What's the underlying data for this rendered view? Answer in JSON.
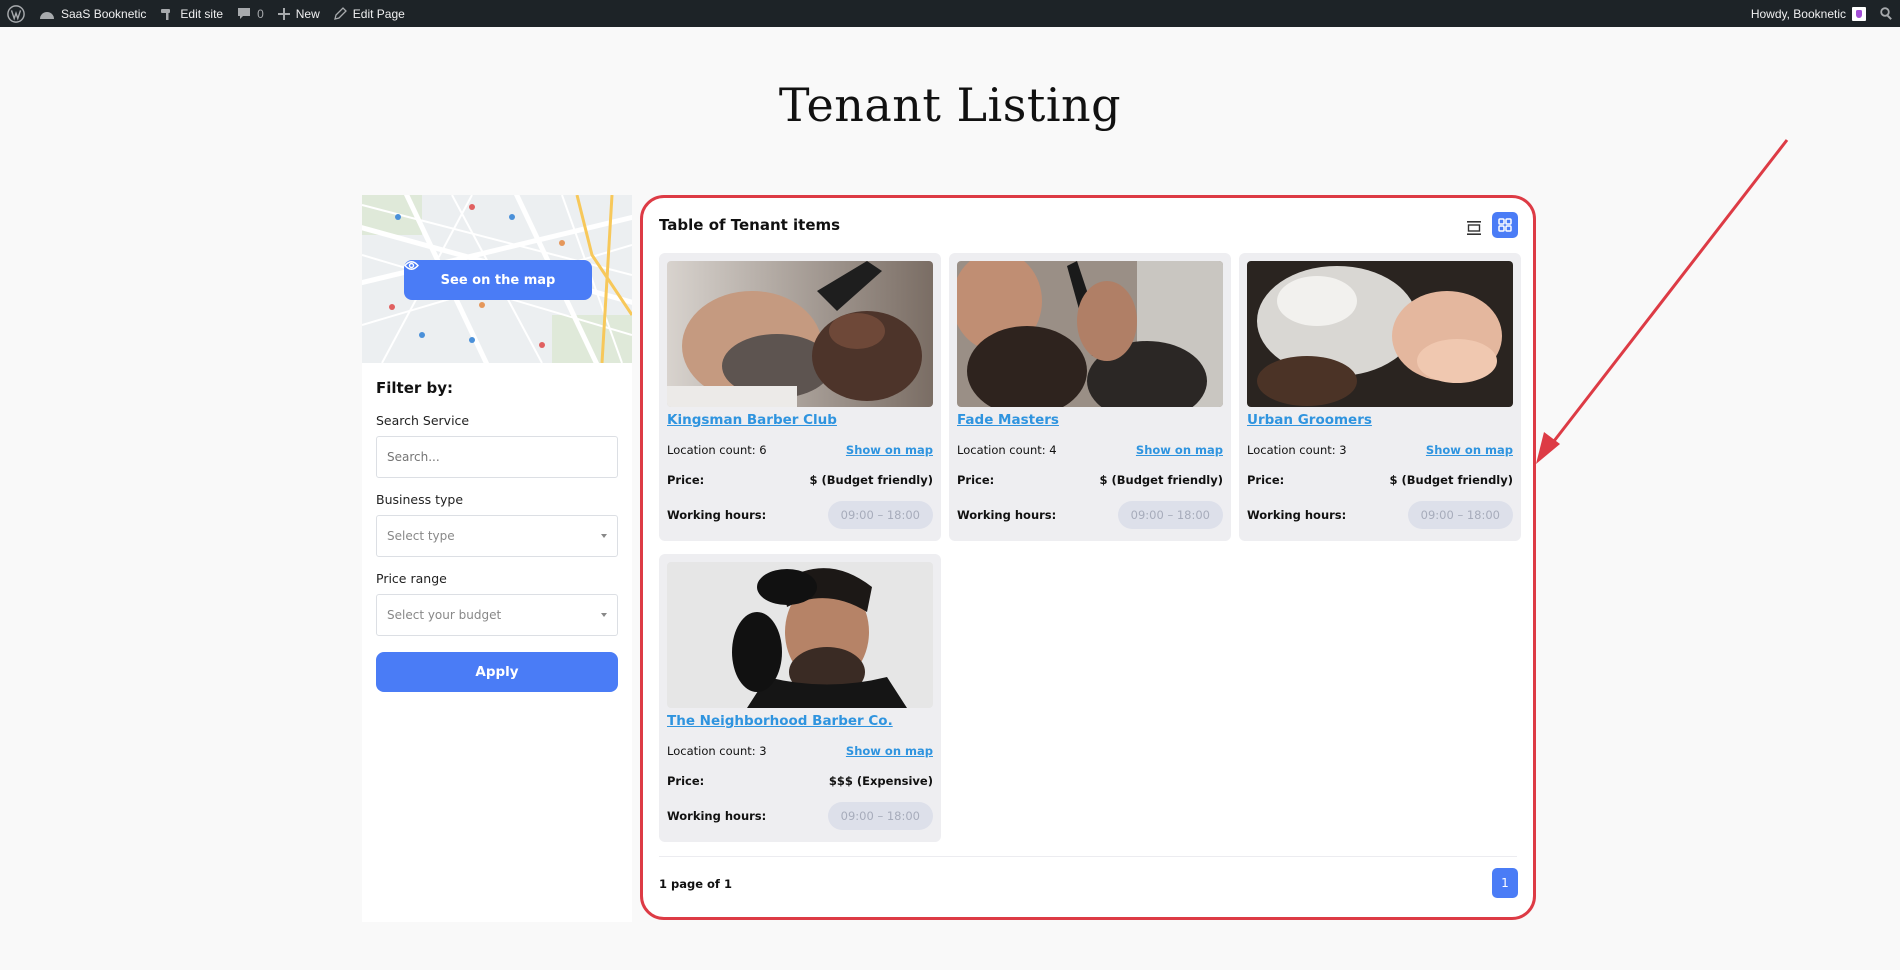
{
  "adminbar": {
    "site_name": "SaaS Booknetic",
    "edit_site": "Edit site",
    "comments_count": "0",
    "new_label": "New",
    "edit_page": "Edit Page",
    "howdy": "Howdy, Booknetic"
  },
  "page": {
    "title": "Tenant Listing"
  },
  "sidebar": {
    "map_button": "See on the map",
    "filter_title": "Filter by:",
    "search_label": "Search Service",
    "search_placeholder": "Search...",
    "business_label": "Business type",
    "business_placeholder": "Select type",
    "price_label": "Price range",
    "price_placeholder": "Select your budget",
    "apply_label": "Apply"
  },
  "listing": {
    "heading": "Table of Tenant items",
    "items": [
      {
        "name": "Kingsman Barber Club",
        "location_label": "Location count: 6",
        "show_map": "Show on map",
        "price_key": "Price:",
        "price": "$ (Budget friendly)",
        "hours_key": "Working hours:",
        "hours": "09:00 – 18:00"
      },
      {
        "name": "Fade Masters",
        "location_label": "Location count: 4",
        "show_map": "Show on map",
        "price_key": "Price:",
        "price": "$ (Budget friendly)",
        "hours_key": "Working hours:",
        "hours": "09:00 – 18:00"
      },
      {
        "name": "Urban Groomers",
        "location_label": "Location count: 3",
        "show_map": "Show on map",
        "price_key": "Price:",
        "price": "$ (Budget friendly)",
        "hours_key": "Working hours:",
        "hours": "09:00 – 18:00"
      },
      {
        "name": "The Neighborhood Barber Co.",
        "location_label": "Location count: 3",
        "show_map": "Show on map",
        "price_key": "Price:",
        "price": "$$$ (Expensive)",
        "hours_key": "Working hours:",
        "hours": "09:00 – 18:00"
      }
    ],
    "pagination_text": "1 page of 1",
    "current_page": "1"
  },
  "colors": {
    "accent": "#4a7cf6",
    "highlight": "#dd3b45",
    "link": "#2f94df"
  }
}
